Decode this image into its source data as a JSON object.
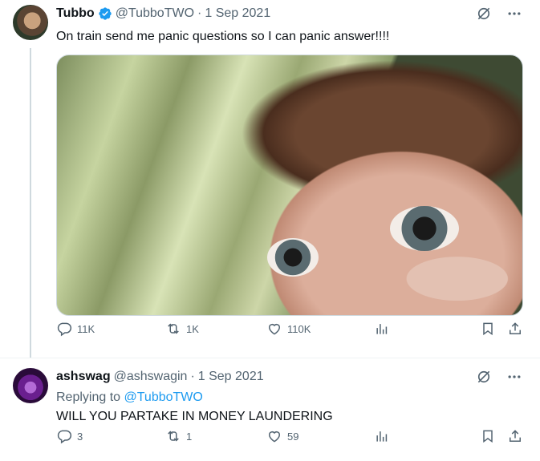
{
  "tweet": {
    "author_name": "Tubbo",
    "handle": "@TubboTWO",
    "separator": "·",
    "date": "1 Sep 2021",
    "text": "On train send me panic questions so I can panic answer!!!!",
    "stats": {
      "replies": "11K",
      "retweets": "1K",
      "likes": "110K"
    }
  },
  "reply": {
    "author_name": "ashswag",
    "handle": "@ashswagin",
    "separator": "·",
    "date": "1 Sep 2021",
    "replying_prefix": "Replying to",
    "replying_handle": "@TubboTWO",
    "text": "WILL YOU PARTAKE IN MONEY LAUNDERING",
    "stats": {
      "replies": "3",
      "retweets": "1",
      "likes": "59"
    }
  },
  "colors": {
    "accent": "#1d9bf0",
    "secondary_text": "#536471",
    "primary_text": "#0f1419"
  },
  "icons": [
    "verified-badge-icon",
    "grok-icon",
    "more-icon",
    "reply-icon",
    "retweet-icon",
    "like-icon",
    "views-icon",
    "bookmark-icon",
    "share-icon"
  ]
}
